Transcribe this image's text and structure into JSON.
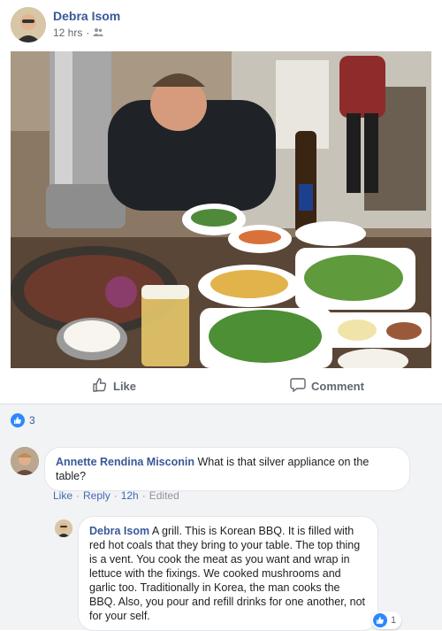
{
  "post": {
    "author": "Debra Isom",
    "time": "12 hrs",
    "audience_icon": "friends-icon"
  },
  "actions": {
    "like_label": "Like",
    "comment_label": "Comment"
  },
  "reactions": {
    "count": "3",
    "icon": "thumbs-up-icon"
  },
  "comments": [
    {
      "author": "Annette Rendina Misconin",
      "text": "What is that silver appliance on the table?",
      "links": {
        "like": "Like",
        "reply": "Reply",
        "time": "12h",
        "edited": "Edited"
      }
    },
    {
      "author": "Debra Isom",
      "text": "A grill. This is Korean BBQ. It is filled with red hot coals that they bring to your table. The top thing is a vent. You cook the meat as you want and wrap in lettuce with the fixings. We cooked mushrooms and garlic too. Traditionally in Korea, the man cooks the BBQ. Also, you pour and refill drinks for one another, not for your self.",
      "reaction_count": "1"
    }
  ],
  "colors": {
    "link": "#385898",
    "reaction": "#2d88ff",
    "comments_bg": "#f2f3f5"
  }
}
